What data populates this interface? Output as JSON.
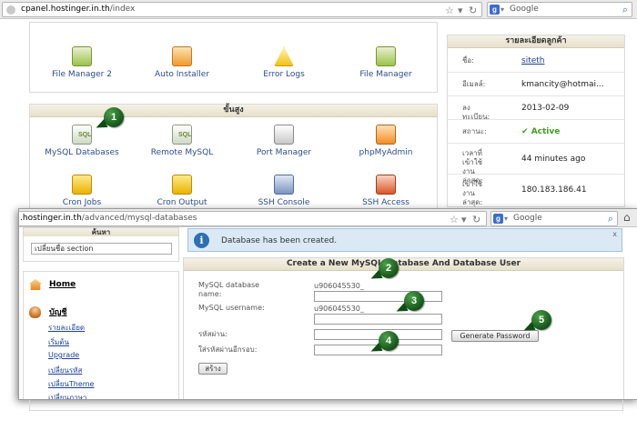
{
  "back_browser": {
    "url_host": "cpanel.hostinger.in.th",
    "url_path": "/index",
    "search_placeholder": "Google"
  },
  "top_tools": [
    {
      "label": "File Manager 2"
    },
    {
      "label": "Auto Installer"
    },
    {
      "label": "Error Logs"
    },
    {
      "label": "File Manager"
    }
  ],
  "advanced": {
    "header": "ขั้นสูง",
    "row1": [
      {
        "label": "MySQL Databases",
        "icon_text": "SQL"
      },
      {
        "label": "Remote MySQL",
        "icon_text": "SQL"
      },
      {
        "label": "Port Manager"
      },
      {
        "label": "phpMyAdmin"
      }
    ],
    "row2": [
      {
        "label": "Cron Jobs"
      },
      {
        "label": "Cron Output"
      },
      {
        "label": "SSH Console"
      },
      {
        "label": "SSH Access"
      }
    ]
  },
  "customer_info": {
    "header": "รายละเอียดลูกค้า",
    "rows": [
      {
        "key": "ชื่อ:",
        "value": "siteth"
      },
      {
        "key": "อีเมลล์:",
        "value": "kmancity@hotmai..."
      },
      {
        "key": "ลงทะเบียน:",
        "value": "2013-02-09"
      },
      {
        "key": "สถานะ:",
        "value": "Active"
      },
      {
        "key": "เวลาที่เข้าใช้งานล่าสุด:",
        "value": "44 minutes ago"
      },
      {
        "key": "เข้าใช้งานล่าสุด:",
        "value": "180.183.186.41"
      }
    ]
  },
  "front_browser": {
    "url_host": ".hostinger.in.th",
    "url_path": "/advanced/mysql-databases",
    "search_placeholder": "Google"
  },
  "sidebar": {
    "search_header": "ค้นหา",
    "search_value": "เปลี่ยนชื่อ section",
    "home_label": "Home",
    "account_label": "บัญชี",
    "account_links": [
      "รายละเอียด",
      "เริ่มต้น",
      "Upgrade",
      "เปลี่ยนรหัส",
      "เปลี่ยนTheme",
      "เปลี่ยนภาษา"
    ]
  },
  "alert": {
    "message": "Database has been created.",
    "close": "x"
  },
  "form": {
    "title": "Create a New MySQL Database And Database User",
    "db_name_label": "MySQL database name:",
    "db_prefix": "u906045530_",
    "username_label": "MySQL username:",
    "user_prefix": "u906045530_",
    "password_label": "รหัสผ่าน:",
    "confirm_label": "ใส่รหัสผ่านอีกรอบ:",
    "generate_button": "Generate Password",
    "create_button": "สร้าง"
  },
  "badges": [
    "1",
    "2",
    "3",
    "4",
    "5"
  ],
  "colors": {
    "badge_green": "#1f6b22",
    "link_blue": "#2b4d8c",
    "active_green": "#3e9d1f",
    "alert_bg": "#dbe9f5"
  }
}
